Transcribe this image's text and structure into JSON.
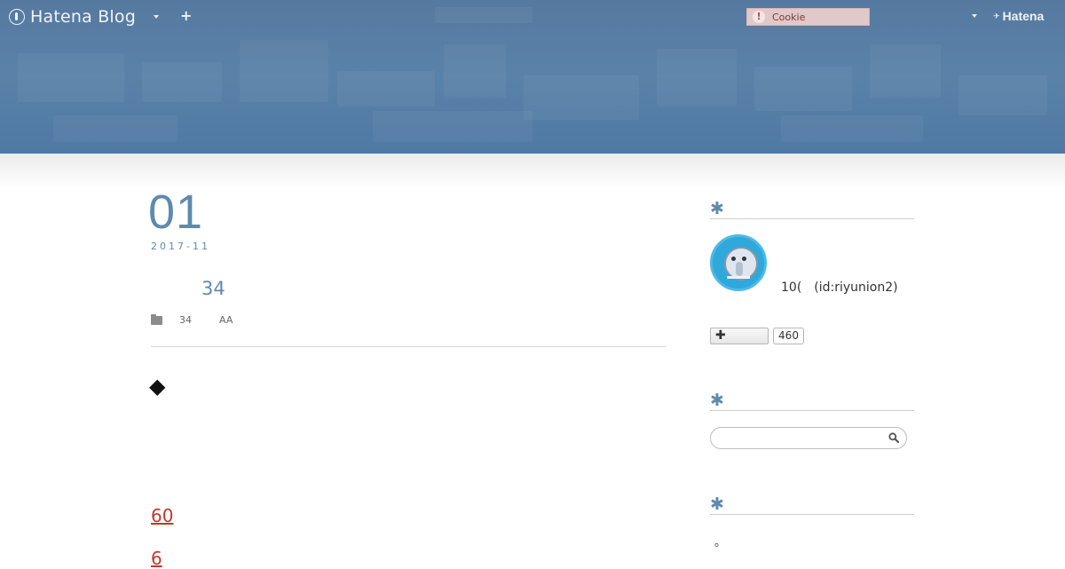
{
  "globalbar": {
    "brand": "Hatena Blog",
    "add_label": "+",
    "cookie_notice": "Cookie",
    "cookie_icon": "!",
    "hatena": "Hatena",
    "colors": {
      "header_bg": "#56799f",
      "accent": "#5f8ab0",
      "link": "#c0392b"
    }
  },
  "entry": {
    "date_day": "01",
    "date_ym": "2017-11",
    "title": "34",
    "categories": [
      "34",
      "AA"
    ],
    "bullet": "◆",
    "links": [
      "60",
      "6"
    ]
  },
  "sidebar": {
    "module_marker": "✱",
    "profile": {
      "name": "10(　(id:riyunion2)"
    },
    "follow": {
      "label": "✚",
      "count": "460"
    },
    "search": {
      "placeholder": ""
    },
    "misc_text": "。"
  }
}
